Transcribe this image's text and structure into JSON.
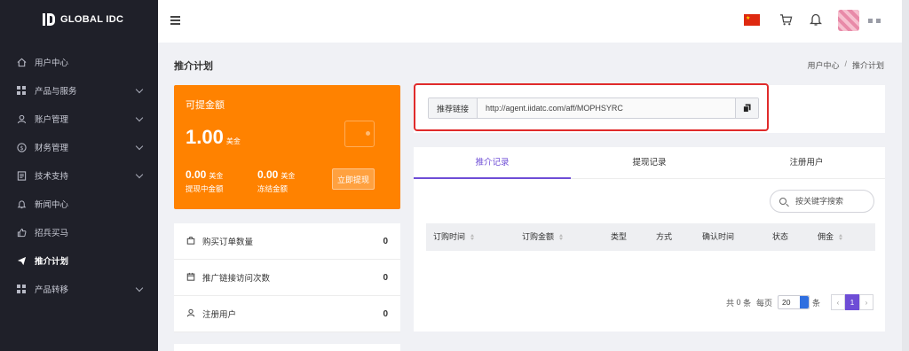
{
  "brand": {
    "name": "GLOBAL IDC"
  },
  "sidebar": {
    "items": [
      {
        "label": "用户中心",
        "icon": "home-icon"
      },
      {
        "label": "产品与服务",
        "icon": "grid-icon",
        "expandable": true
      },
      {
        "label": "账户管理",
        "icon": "user-icon",
        "expandable": true
      },
      {
        "label": "财务管理",
        "icon": "dollar-icon",
        "expandable": true
      },
      {
        "label": "技术支持",
        "icon": "document-icon",
        "expandable": true
      },
      {
        "label": "新闻中心",
        "icon": "bell-icon"
      },
      {
        "label": "招兵买马",
        "icon": "thumbs-up-icon"
      },
      {
        "label": "推介计划",
        "icon": "send-icon",
        "active": true
      },
      {
        "label": "产品转移",
        "icon": "grid-icon",
        "expandable": true
      }
    ]
  },
  "header": {
    "flag": "china-flag",
    "accent": "#de2910"
  },
  "page": {
    "title": "推介计划"
  },
  "breadcrumb": {
    "home": "用户中心",
    "sep": "/",
    "current": "推介计划"
  },
  "balance": {
    "heading": "可提金额",
    "amount": "1.00",
    "unit": "美金",
    "pending_value": "0.00",
    "pending_unit": "美金",
    "pending_label": "提现中金额",
    "frozen_value": "0.00",
    "frozen_unit": "美金",
    "frozen_label": "冻结金额",
    "withdraw_button": "立即提现",
    "color": "#ff8200"
  },
  "stats": [
    {
      "label": "购买订单数量",
      "value": "0",
      "icon": "lock-bag-icon"
    },
    {
      "label": "推广链接访问次数",
      "value": "0",
      "icon": "calendar-icon"
    },
    {
      "label": "注册用户",
      "value": "0",
      "icon": "user-icon"
    }
  ],
  "referral": {
    "label": "推荐链接",
    "url": "http://agent.iidatc.com/aff/MOPHSYRC"
  },
  "tabs": [
    {
      "label": "推介记录",
      "active": true
    },
    {
      "label": "提现记录"
    },
    {
      "label": "注册用户"
    }
  ],
  "search": {
    "placeholder": "按关键字搜索"
  },
  "table": {
    "columns": [
      "订购时间",
      "订购金额",
      "类型",
      "方式",
      "确认时间",
      "状态",
      "佣金"
    ]
  },
  "pagination": {
    "total_prefix": "共",
    "total": "0",
    "total_suffix": "条",
    "per_page_prefix": "每页",
    "per_page": "20",
    "per_page_suffix": "条",
    "prev": "‹",
    "current_page": "1",
    "next": "›"
  },
  "accent_color": "#6e4dd6"
}
